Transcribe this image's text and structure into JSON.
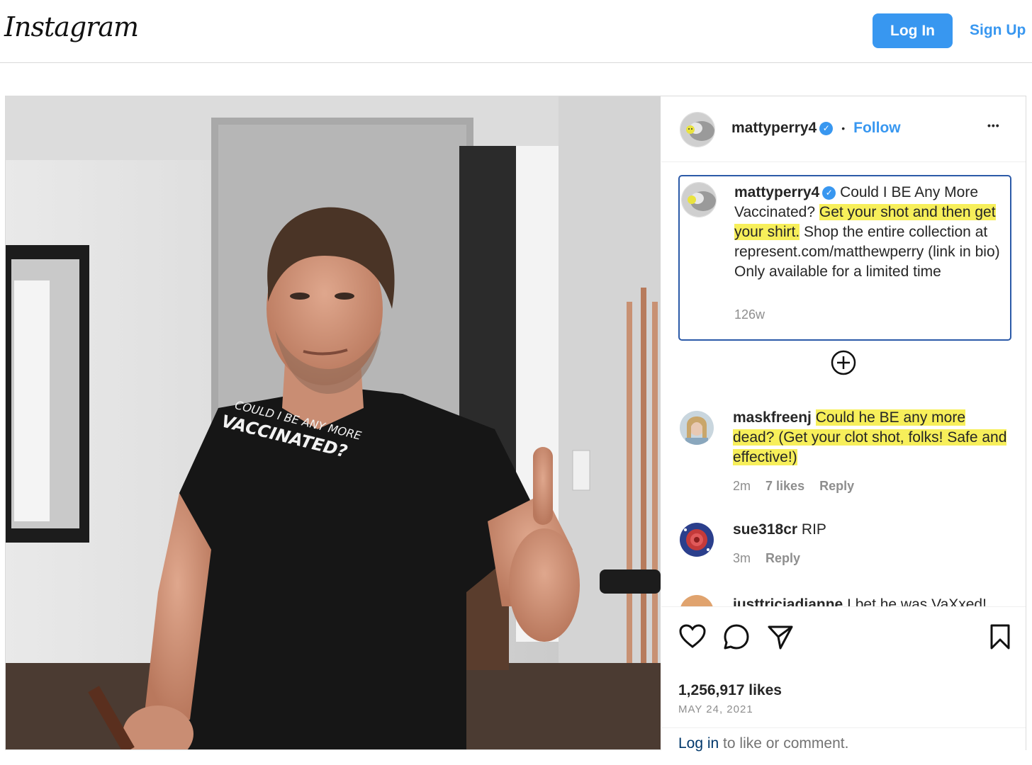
{
  "header": {
    "logo_text": "Instagram",
    "login_label": "Log In",
    "signup_label": "Sign Up"
  },
  "post": {
    "photo_shirt_text_line1": "COULD I BE ANY MORE",
    "photo_shirt_text_line2": "VACCINATED?",
    "author": "mattyperry4",
    "separator": "•",
    "follow_label": "Follow",
    "more_label": "•••",
    "caption": {
      "username": "mattyperry4",
      "text_plain_1": " Could I BE Any More Vaccinated? ",
      "text_highlight": "Get your shot and then get your shirt.",
      "text_plain_2": " Shop the entire collection at represent.com/matthewperry (link in bio) Only available for a limited time",
      "age": "126w"
    },
    "load_more_icon": "plus-circle-icon",
    "comments": [
      {
        "username": "maskfreenj",
        "text": "Could he BE any more dead? (Get your clot shot, folks! Safe and effective!)",
        "highlighted": true,
        "age": "2m",
        "likes": "7 likes",
        "reply_label": "Reply"
      },
      {
        "username": "sue318cr",
        "text": "RIP",
        "highlighted": false,
        "age": "3m",
        "reply_label": "Reply"
      },
      {
        "username": "justtriciadianne",
        "text": "I bet he was VaXxed!",
        "highlighted": false
      }
    ],
    "likes_count": "1,256,917 likes",
    "date": "MAY 24, 2021",
    "login_prompt_link": "Log in",
    "login_prompt_rest": " to like or comment."
  },
  "colors": {
    "accent_blue": "#3897f0",
    "highlight_yellow": "#f7ef5a",
    "caption_border": "#2c5aa8"
  }
}
